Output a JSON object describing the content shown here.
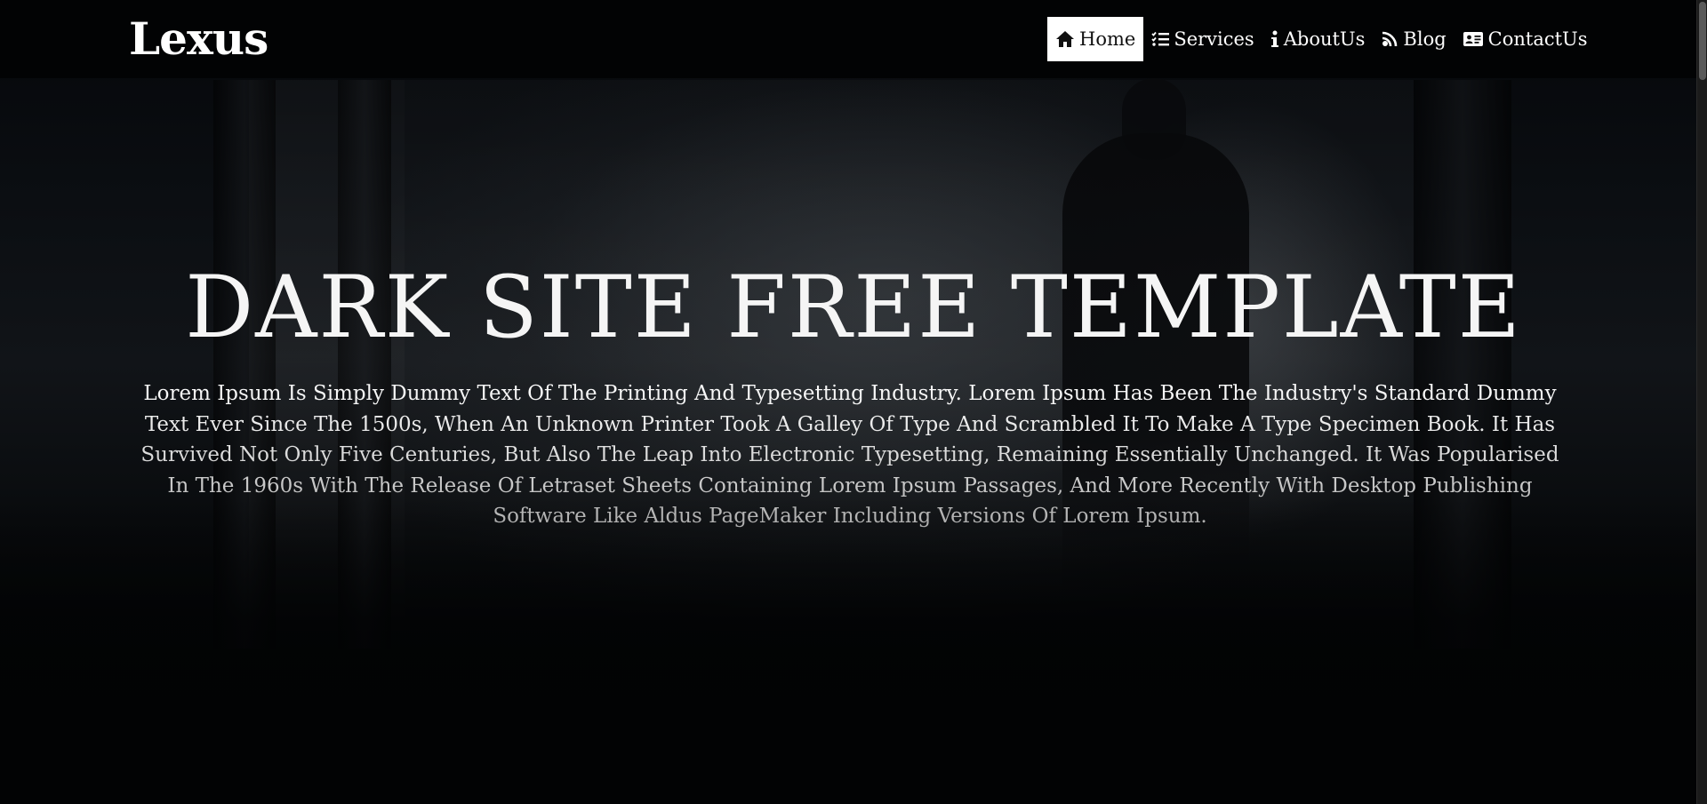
{
  "brand": {
    "logo": "Lexus"
  },
  "nav": {
    "items": [
      {
        "label": "Home",
        "icon": "home-icon",
        "active": true
      },
      {
        "label": "Services",
        "icon": "checklist-icon",
        "active": false
      },
      {
        "label": "AboutUs",
        "icon": "info-icon",
        "active": false
      },
      {
        "label": "Blog",
        "icon": "rss-icon",
        "active": false
      },
      {
        "label": "ContactUs",
        "icon": "address-card-icon",
        "active": false
      }
    ]
  },
  "hero": {
    "title": "DARK SITE FREE TEMPLATE",
    "text": "Lorem Ipsum Is Simply Dummy Text Of The Printing And Typesetting Industry. Lorem Ipsum Has Been The Industry's Standard Dummy Text Ever Since The 1500s, When An Unknown Printer Took A Galley Of Type And Scrambled It To Make A Type Specimen Book. It Has Survived Not Only Five Centuries, But Also The Leap Into Electronic Typesetting, Remaining Essentially Unchanged. It Was Popularised In The 1960s With The Release Of Letraset Sheets Containing Lorem Ipsum Passages, And More Recently With Desktop Publishing Software Like Aldus PageMaker Including Versions Of Lorem Ipsum."
  },
  "colors": {
    "background": "#030406",
    "text": "#ffffff",
    "active_nav_bg": "#ffffff",
    "active_nav_text": "#111111"
  }
}
